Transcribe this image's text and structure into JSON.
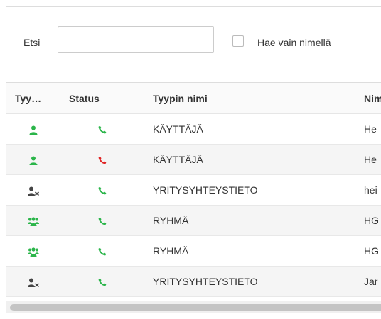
{
  "search": {
    "label": "Etsi",
    "value": "",
    "placeholder": "",
    "name_only_label": "Hae vain nimellä",
    "name_only_checked": false
  },
  "columns": {
    "type": "Tyy…",
    "status": "Status",
    "type_name": "Tyypin nimi",
    "name": "Nim"
  },
  "colors": {
    "green": "#2bb54a",
    "red": "#e02424",
    "dark": "#444444"
  },
  "rows": [
    {
      "type_icon": "user-icon",
      "status_icon": "phone-icon",
      "status": "available",
      "type_name": "KÄYTTÄJÄ",
      "name": "He"
    },
    {
      "type_icon": "user-icon",
      "status_icon": "phone-icon",
      "status": "busy",
      "type_name": "KÄYTTÄJÄ",
      "name": "He"
    },
    {
      "type_icon": "contact-icon",
      "status_icon": "phone-icon",
      "status": "available",
      "type_name": "YRITYSYHTEYSTIETO",
      "name": "hei"
    },
    {
      "type_icon": "group-icon",
      "status_icon": "phone-icon",
      "status": "available",
      "type_name": "RYHMÄ",
      "name": "HG"
    },
    {
      "type_icon": "group-icon",
      "status_icon": "phone-icon",
      "status": "available",
      "type_name": "RYHMÄ",
      "name": "HG"
    },
    {
      "type_icon": "contact-icon",
      "status_icon": "phone-icon",
      "status": "available",
      "type_name": "YRITYSYHTEYSTIETO",
      "name": "Jar"
    }
  ]
}
